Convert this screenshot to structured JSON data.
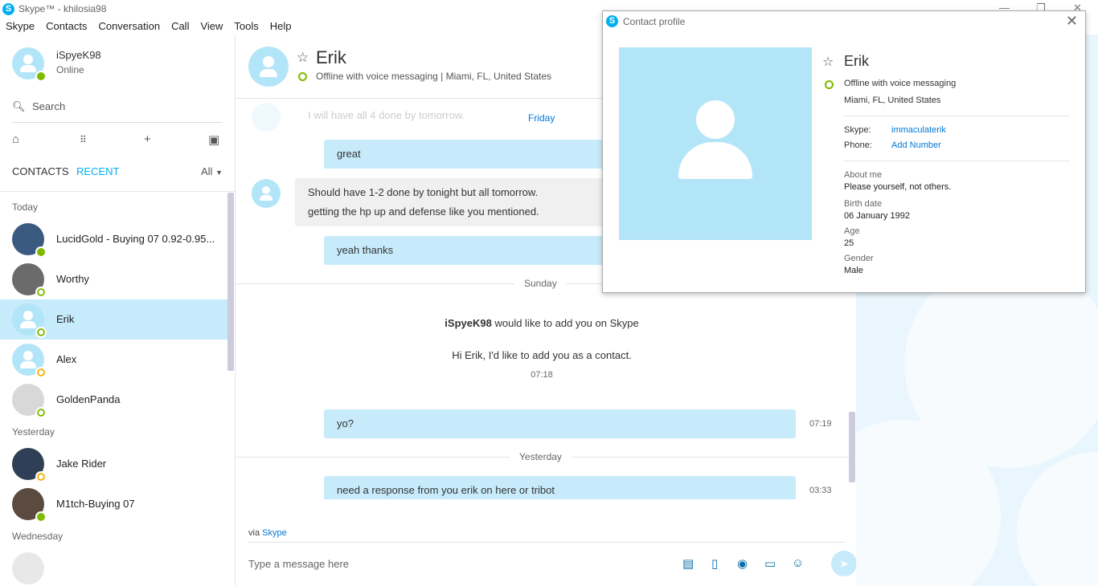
{
  "window": {
    "title": "Skype™ - khilosia98"
  },
  "menu": [
    "Skype",
    "Contacts",
    "Conversation",
    "Call",
    "View",
    "Tools",
    "Help"
  ],
  "me": {
    "name": "iSpyeK98",
    "status": "Online"
  },
  "search": {
    "placeholder": "Search"
  },
  "tabs": {
    "contacts": "CONTACTS",
    "recent": "RECENT",
    "filter": "All"
  },
  "recent": {
    "today_label": "Today",
    "today": [
      {
        "name": "LucidGold - Buying 07 0.92-0.95...",
        "status": "online"
      },
      {
        "name": "Worthy",
        "status": "offline"
      },
      {
        "name": "Erik",
        "status": "offline",
        "selected": true
      },
      {
        "name": "Alex",
        "status": "away"
      },
      {
        "name": "GoldenPanda",
        "status": "offline"
      }
    ],
    "yesterday_label": "Yesterday",
    "yesterday": [
      {
        "name": "Jake Rider",
        "status": "away"
      },
      {
        "name": "M1tch-Buying 07",
        "status": "online"
      }
    ],
    "wednesday_label": "Wednesday"
  },
  "conversation": {
    "contact_name": "Erik",
    "contact_status": "Offline with voice messaging  |  Miami, FL, United States",
    "faded_message": "I will have all 4 done by tomorrow.",
    "day_friday": "Friday",
    "msg_great": "great",
    "msg_incoming_1": "Should have 1-2 done by tonight but all tomorrow.",
    "msg_incoming_2": "getting the hp up and defense like you mentioned.",
    "msg_thanks": "yeah thanks",
    "day_sunday": "Sunday",
    "add_request_user": "iSpyeK98",
    "add_request_text": "would like to add you on Skype",
    "add_request_note": "Hi Erik, I'd like to add you as a contact.",
    "add_request_time": "07:18",
    "msg_yo": "yo?",
    "msg_yo_time": "07:19",
    "day_yesterday": "Yesterday",
    "msg_response": "need a response from you erik on here or tribot",
    "msg_response_time": "03:33",
    "via_text": "via",
    "via_link": "Skype",
    "composer_placeholder": "Type a message here"
  },
  "profile": {
    "dialog_title": "Contact profile",
    "name": "Erik",
    "status": "Offline with voice messaging",
    "location": "Miami, FL, United States",
    "skype_label": "Skype:",
    "skype_value": "immaculaterik",
    "phone_label": "Phone:",
    "phone_value": "Add Number",
    "about_label": "About me",
    "about_value": "Please yourself, not others.",
    "birth_label": "Birth date",
    "birth_value": "06 January 1992",
    "age_label": "Age",
    "age_value": "25",
    "gender_label": "Gender",
    "gender_value": "Male"
  },
  "colors": {
    "accent": "#00aff0",
    "bubble": "#c7ebfb",
    "online": "#7fba00",
    "away": "#f8b00a",
    "selected_row": "#c6ebfb"
  }
}
